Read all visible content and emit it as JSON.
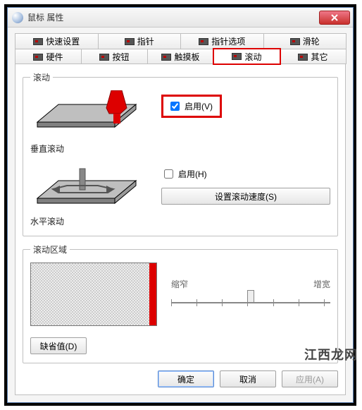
{
  "window": {
    "title": "鼠标 属性"
  },
  "tabs_row1": [
    {
      "label": "快速设置"
    },
    {
      "label": "指针"
    },
    {
      "label": "指针选项"
    },
    {
      "label": "滑轮"
    }
  ],
  "tabs_row2": [
    {
      "label": "硬件"
    },
    {
      "label": "按钮"
    },
    {
      "label": "触摸板"
    },
    {
      "label": "滚动"
    },
    {
      "label": "其它"
    }
  ],
  "scroll_group": {
    "legend": "滚动",
    "vertical_label": "垂直滚动",
    "horizontal_label": "水平滚动",
    "enable_v": "启用(V)",
    "enable_h": "启用(H)",
    "speed_btn": "设置滚动速度(S)"
  },
  "area_group": {
    "legend": "滚动区域",
    "narrow": "缩窄",
    "widen": "增宽",
    "defaults_btn": "缺省值(D)"
  },
  "buttons": {
    "ok": "确定",
    "cancel": "取消",
    "apply": "应用(A)"
  },
  "watermark": "江西龙网"
}
